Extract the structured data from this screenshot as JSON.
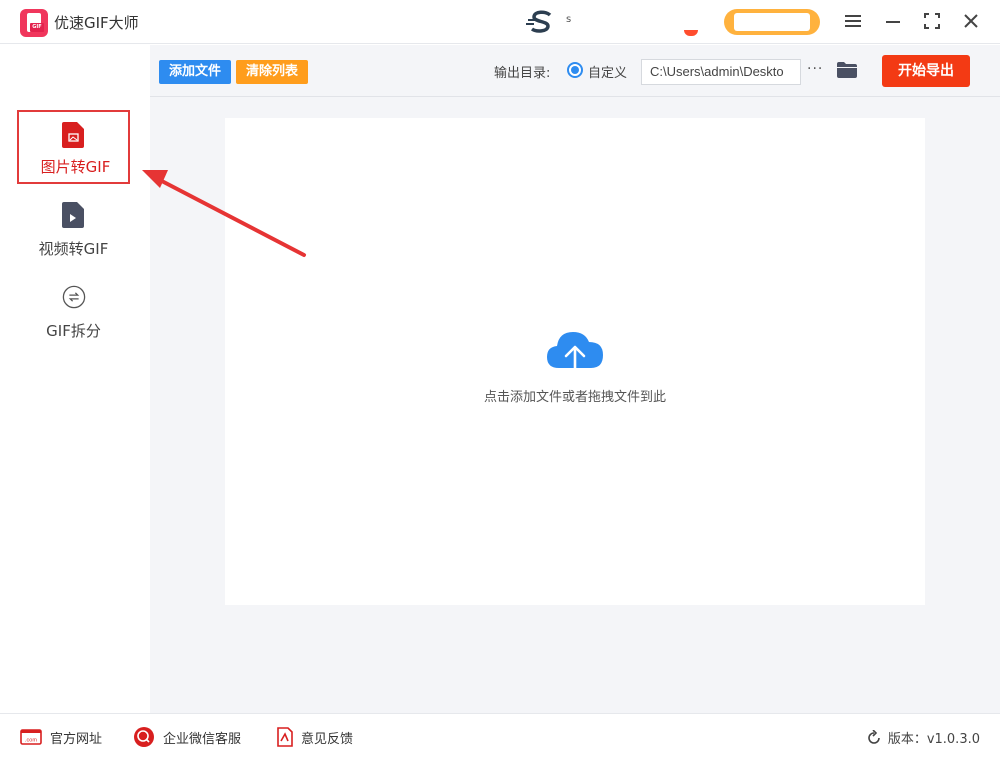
{
  "app": {
    "title": "优速GIF大师",
    "logo_tag": "GIF"
  },
  "titlebar": {
    "brand_glyph": "$",
    "brand_text": "s"
  },
  "sidebar": {
    "items": [
      {
        "label": "图片转GIF",
        "icon": "image-file-icon",
        "active": true
      },
      {
        "label": "视频转GIF",
        "icon": "video-file-icon",
        "active": false
      },
      {
        "label": "GIF拆分",
        "icon": "split-icon",
        "active": false
      }
    ]
  },
  "toolbar": {
    "add_label": "添加文件",
    "clear_label": "清除列表",
    "output_label": "输出目录:",
    "radio_label": "自定义",
    "path_value": "C:\\Users\\admin\\Deskto",
    "more_label": "···",
    "export_label": "开始导出"
  },
  "dropzone": {
    "text": "点击添加文件或者拖拽文件到此"
  },
  "footer": {
    "website": "官方网址",
    "wechat": "企业微信客服",
    "feedback": "意见反馈",
    "version": "版本：v1.0.3.0",
    "website_icon_text": ".com"
  },
  "colors": {
    "accent_blue": "#2e8cf0",
    "accent_orange": "#ff9d1c",
    "export_red": "#f33a14",
    "active_red": "#d81f1f"
  }
}
